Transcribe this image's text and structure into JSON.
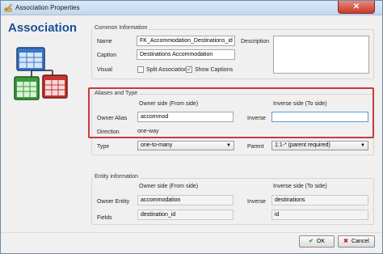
{
  "window": {
    "title": "Association Properties",
    "close_label": "✕"
  },
  "left": {
    "heading": "Association"
  },
  "common": {
    "group_title": "Common Information",
    "name_label": "Name",
    "name_value": "FK_Accommodation_Destinations_id",
    "description_label": "Description",
    "caption_label": "Caption",
    "caption_value": "Destinations Accommodation",
    "visual_label": "Visual",
    "split_label": "Split Association",
    "show_captions_label": "Show Captions",
    "split_checked": false,
    "show_captions_checked": true
  },
  "aliases": {
    "group_title": "Aliases and Type",
    "owner_side_header": "Owner side (From side)",
    "inverse_side_header": "Inverse side (To side)",
    "owner_alias_label": "Owner Alias",
    "owner_alias_value": "accommod",
    "inverse_label": "Inverse",
    "inverse_value": "",
    "direction_label": "Direction",
    "direction_value": "one-way",
    "type_label": "Type",
    "type_value": "one-to-many",
    "parent_label": "Parent",
    "parent_value": "1:1-* (parent required)"
  },
  "entity": {
    "group_title": "Entity information",
    "owner_side_header": "Owner side (From side)",
    "inverse_side_header": "Inverse side (To side)",
    "owner_entity_label": "Owner Entity",
    "owner_entity_value": "accommodation",
    "inverse_label": "Inverse",
    "inverse_value": "destinations",
    "fields_label": "Fields",
    "owner_fields_value": "destination_id",
    "inverse_fields_value": "id"
  },
  "buttons": {
    "ok_label": "OK",
    "cancel_label": "Cancel",
    "ok_icon": "check-icon",
    "cancel_icon": "x-icon"
  },
  "colors": {
    "heading": "#1a4f97",
    "highlight": "#c83a3a",
    "ok_check": "#2e9b2e",
    "cancel_x": "#c62828"
  }
}
